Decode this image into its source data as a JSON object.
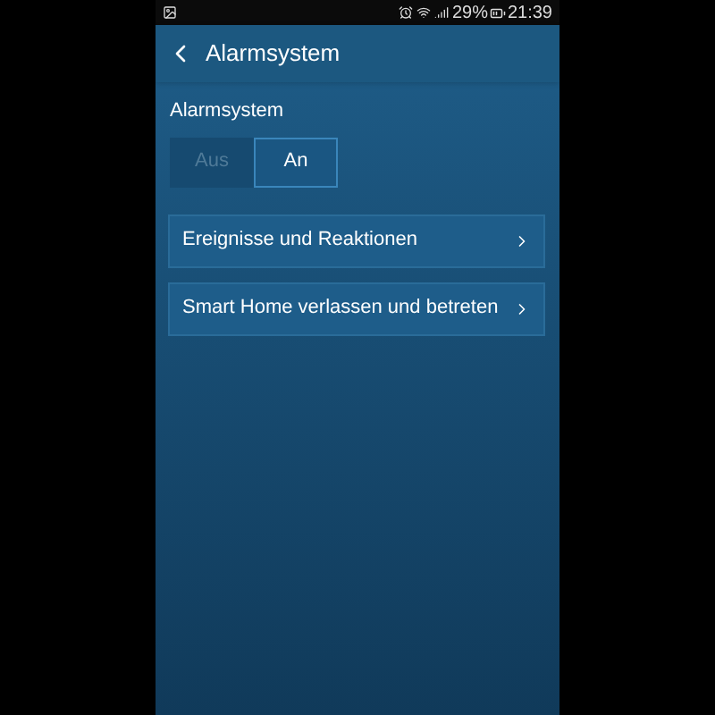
{
  "status_bar": {
    "battery": "29%",
    "time": "21:39"
  },
  "header": {
    "title": "Alarmsystem"
  },
  "section": {
    "label": "Alarmsystem"
  },
  "toggle": [
    {
      "label": "Aus",
      "selected": false
    },
    {
      "label": "An",
      "selected": true
    }
  ],
  "menu": [
    {
      "label": "Ereignisse und Reaktionen"
    },
    {
      "label": "Smart Home verlassen und betreten"
    }
  ]
}
